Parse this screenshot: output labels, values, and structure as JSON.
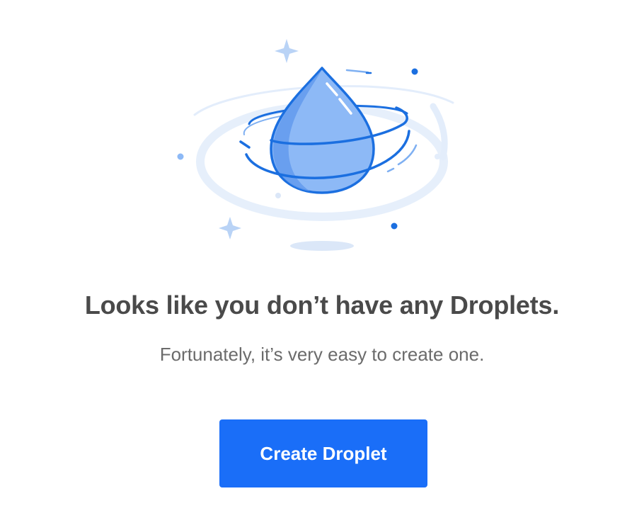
{
  "empty_state": {
    "headline": "Looks like you don’t have any Droplets.",
    "subtext": "Fortunately, it’s very easy to create one.",
    "create_button_label": "Create Droplet",
    "illustration_icon": "droplet-icon"
  },
  "colors": {
    "accent": "#1a6ef8",
    "headline_text": "#4a4a4a",
    "subtext_text": "#6b6b6b",
    "illustration_stroke": "#1b6fe0",
    "illustration_fill_light": "#dde9fa",
    "droplet_fill": "#7ab0f5"
  }
}
